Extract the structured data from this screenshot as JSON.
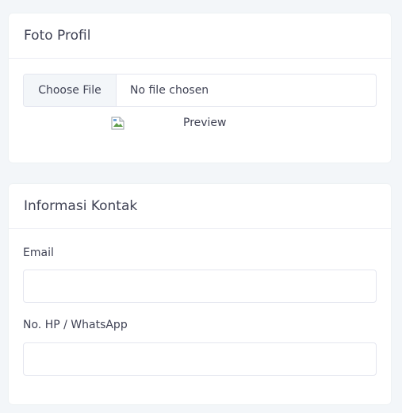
{
  "foto_profil": {
    "title": "Foto Profil",
    "file_button": "Choose File",
    "file_status": "No file chosen",
    "preview_alt": "Preview"
  },
  "informasi_kontak": {
    "title": "Informasi Kontak",
    "email_label": "Email",
    "email_value": "",
    "phone_label": "No. HP / WhatsApp",
    "phone_value": ""
  }
}
